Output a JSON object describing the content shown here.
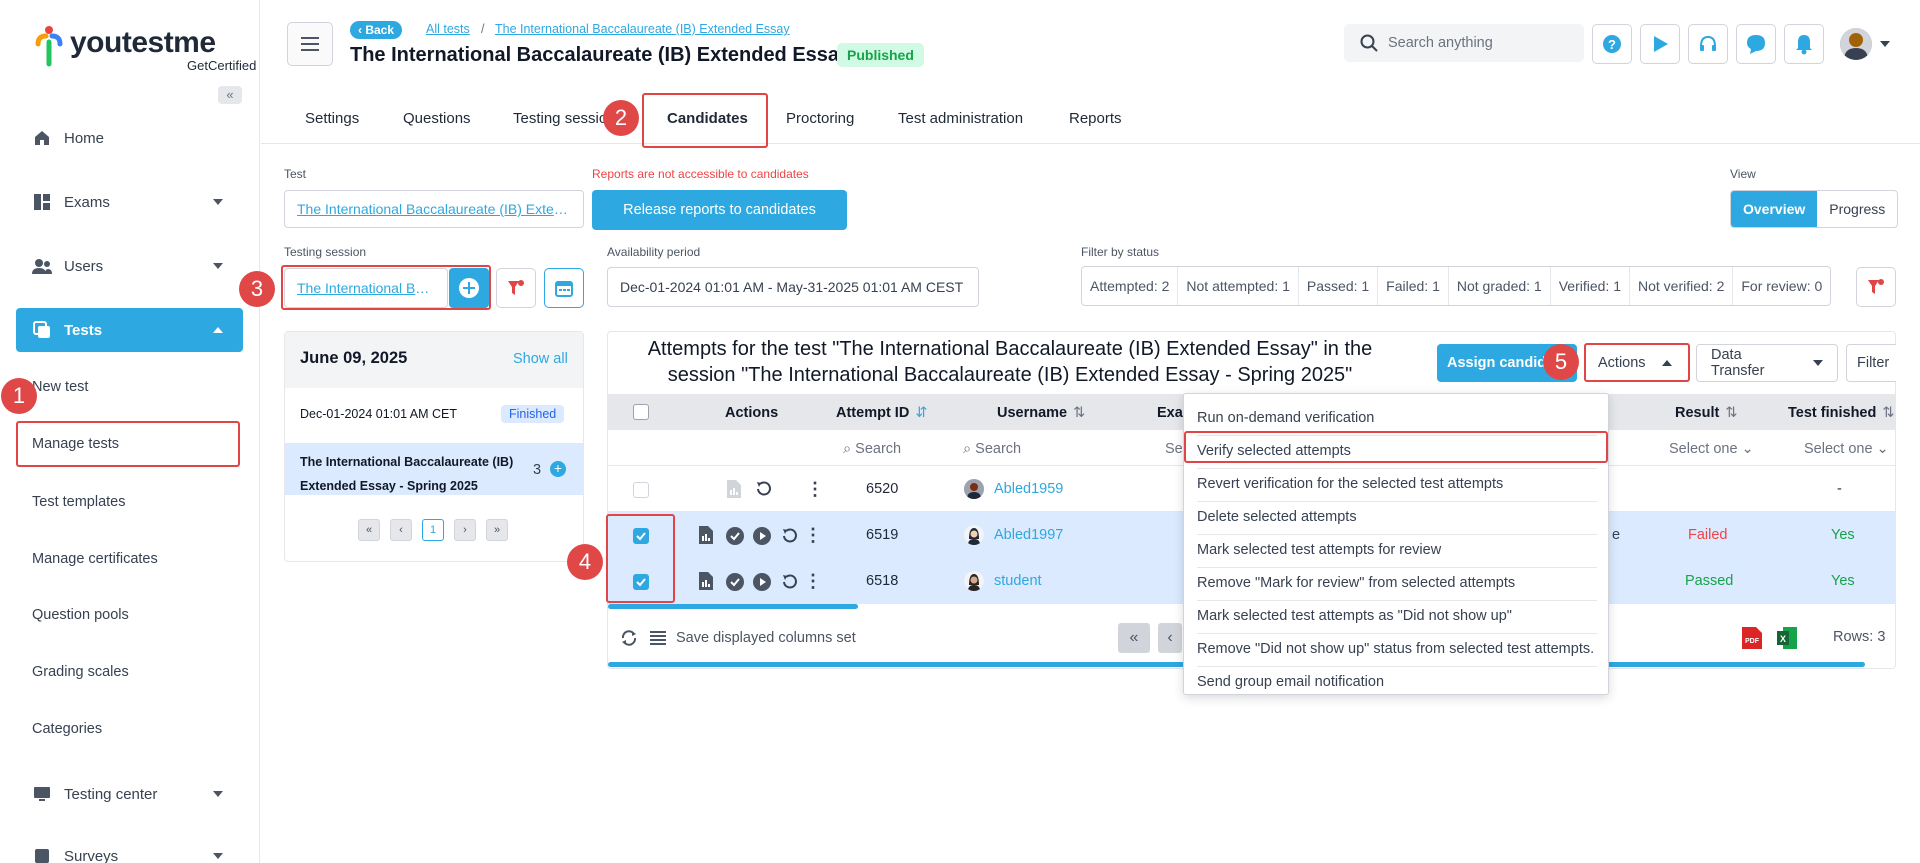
{
  "brand": {
    "name": "youtestme",
    "tagline": "GetCertified"
  },
  "sidebar": {
    "collapse_label": "«",
    "items": [
      {
        "label": "Home",
        "icon": "home-icon"
      },
      {
        "label": "Exams",
        "icon": "exams-icon"
      },
      {
        "label": "Users",
        "icon": "users-icon"
      },
      {
        "label": "Tests",
        "icon": "tests-icon"
      },
      {
        "label": "Testing center",
        "icon": "testing-center-icon"
      },
      {
        "label": "Surveys",
        "icon": "surveys-icon"
      }
    ],
    "sub_items": [
      "New test",
      "Manage tests",
      "Test templates",
      "Manage certificates",
      "Question pools",
      "Grading scales",
      "Categories"
    ]
  },
  "header": {
    "back_label": "Back",
    "crumb_all": "All tests",
    "crumb_sep": "/",
    "crumb_current": "The International Baccalaureate (IB) Extended Essay",
    "title": "The International Baccalaureate (IB) Extended Essay",
    "status_badge": "Published",
    "search_placeholder": "Search anything"
  },
  "tabs": [
    "Settings",
    "Questions",
    "Testing sessions",
    "Candidates",
    "Proctoring",
    "Test administration",
    "Reports"
  ],
  "filters": {
    "test_label": "Test",
    "test_value": "The International Baccalaureate (IB) Extended Essay",
    "reports_warning": "Reports are not accessible to candidates",
    "release_button": "Release reports to candidates",
    "view_label": "View",
    "view_options": [
      "Overview",
      "Progress"
    ],
    "session_label": "Testing session",
    "session_value": "The International Baccalaureate (IB) Extended Essay - Spring 2025",
    "availability_label": "Availability period",
    "availability_value": "Dec-01-2024 01:01 AM - May-31-2025 01:01 AM CEST",
    "status_label": "Filter by status",
    "status_counts": [
      "Attempted: 2",
      "Not attempted: 1",
      "Passed: 1",
      "Failed: 1",
      "Not graded: 1",
      "Verified: 1",
      "Not verified: 2",
      "For review: 0"
    ]
  },
  "session_card": {
    "date": "June 09, 2025",
    "show_all": "Show all",
    "session_date": "Dec-01-2024 01:01 AM CET",
    "session_status": "Finished",
    "session_name_line1": "The International Baccalaureate (IB)",
    "session_name_line2": "Extended Essay - Spring 2025",
    "session_count": "3",
    "pager": {
      "first": "«",
      "prev": "‹",
      "page": "1",
      "next": "›",
      "last": "»"
    }
  },
  "table": {
    "title_line1": "Attempts for the test \"The International Baccalaureate (IB) Extended Essay\" in the",
    "title_line2": "session \"The International Baccalaureate (IB) Extended Essay - Spring 2025\"",
    "assign_button": "Assign candidates",
    "actions_button": "Actions",
    "data_transfer_button": "Data Transfer",
    "filter_button": "Filter",
    "columns": {
      "actions": "Actions",
      "attempt_id": "Attempt ID",
      "username": "Username",
      "exam": "Exam",
      "result": "Result",
      "test_finished": "Test finished"
    },
    "search_placeholder": "Search",
    "select_one": "Select one",
    "select_short": "Sel",
    "rows": [
      {
        "attempt_id": "6520",
        "username": "Abled1959",
        "result": "",
        "finished": "-",
        "selected": false
      },
      {
        "attempt_id": "6519",
        "username": "Abled1997",
        "result": "Failed",
        "finished": "Yes",
        "selected": true,
        "partial": "e"
      },
      {
        "attempt_id": "6518",
        "username": "student",
        "result": "Passed",
        "finished": "Yes",
        "selected": true
      }
    ],
    "save_columns": "Save displayed columns set",
    "rows_count": "Rows: 3"
  },
  "actions_menu": [
    "Run on-demand verification",
    "Verify selected attempts",
    "Revert verification for the selected test attempts",
    "Delete selected attempts",
    "Mark selected test attempts for review",
    "Remove \"Mark for review\" from selected attempts",
    "Mark selected test attempts as \"Did not show up\"",
    "Remove \"Did not show up\" status from selected test attempts.",
    "Send group email notification"
  ],
  "markers": [
    "1",
    "2",
    "3",
    "4",
    "5"
  ],
  "colors": {
    "accent": "#2ea8e0",
    "highlight": "#e24545",
    "passed": "#16a34a",
    "failed": "#ef4444"
  }
}
